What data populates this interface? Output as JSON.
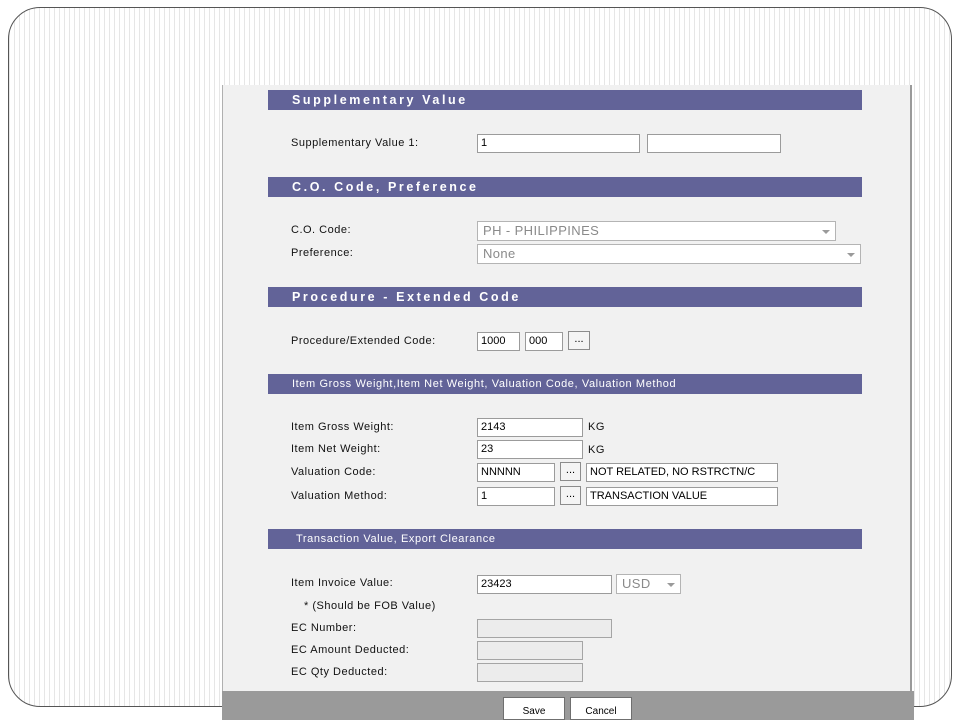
{
  "sections": {
    "supplementary": {
      "title": "Supplementary Value",
      "label": "Supplementary Value 1:",
      "value1": "1",
      "value2": ""
    },
    "co": {
      "title": "C.O. Code, Preference",
      "co_label": "C.O. Code:",
      "co_value": "PH - PHILIPPINES",
      "pref_label": "Preference:",
      "pref_value": "None"
    },
    "procedure": {
      "title": "Procedure - Extended Code",
      "label": "Procedure/Extended Code:",
      "code": "1000",
      "ext": "000",
      "lookup": "..."
    },
    "weight": {
      "title": "Item Gross Weight,Item Net Weight, Valuation Code, Valuation Method",
      "gross_label": "Item Gross Weight:",
      "gross_value": "2143",
      "gross_unit": "KG",
      "net_label": "Item Net Weight:",
      "net_value": "23",
      "net_unit": "KG",
      "valcode_label": "Valuation Code:",
      "valcode_value": "NNNNN",
      "valcode_lookup": "...",
      "valcode_desc": "NOT RELATED, NO RSTRCTN/C",
      "valmethod_label": "Valuation Method:",
      "valmethod_value": "1",
      "valmethod_lookup": "...",
      "valmethod_desc": "TRANSACTION VALUE"
    },
    "transaction": {
      "title": "Transaction Value, Export Clearance",
      "invoice_label": "Item Invoice Value:",
      "invoice_value": "23423",
      "currency": "USD",
      "fob_note": "* (Should be FOB Value)",
      "ec_number_label": "EC Number:",
      "ec_number_value": "",
      "ec_amount_label": "EC Amount Deducted:",
      "ec_amount_value": "",
      "ec_qty_label": "EC Qty Deducted:",
      "ec_qty_value": ""
    }
  },
  "footer": {
    "save_label": "Save",
    "cancel_label": "Cancel"
  },
  "colors": {
    "section_bar": "#626398",
    "panel_bg": "#f1f1f1",
    "footer_bar": "#9a9a9a"
  }
}
